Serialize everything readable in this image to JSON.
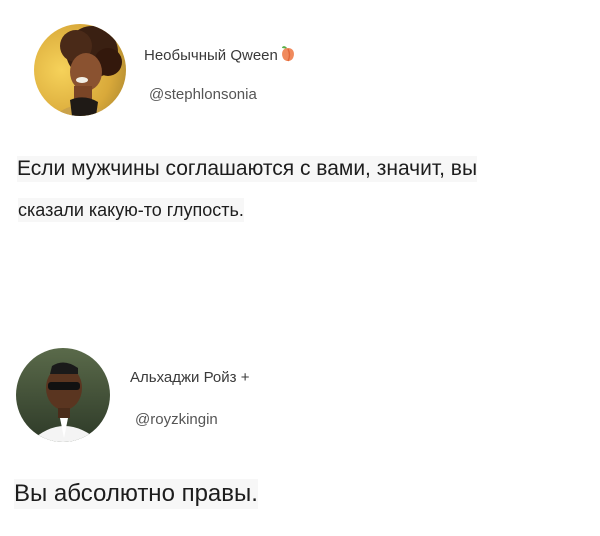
{
  "tweets": [
    {
      "author_name": "Необычный Qween",
      "author_emoji": "peach-emoji",
      "handle": "@stephlonsonia",
      "text_lines": [
        "Если мужчины соглашаются с вами, значит, вы",
        "сказали какую-то глупость."
      ]
    },
    {
      "author_name": "Альхаджи Ройз +",
      "handle": "@royzkingin",
      "text_lines": [
        "Вы абсолютно правы."
      ]
    }
  ],
  "colors": {
    "background": "#ffffff",
    "text": "#1d1d1d",
    "secondary_text": "#555555",
    "text_highlight": "#f7f7f7"
  }
}
